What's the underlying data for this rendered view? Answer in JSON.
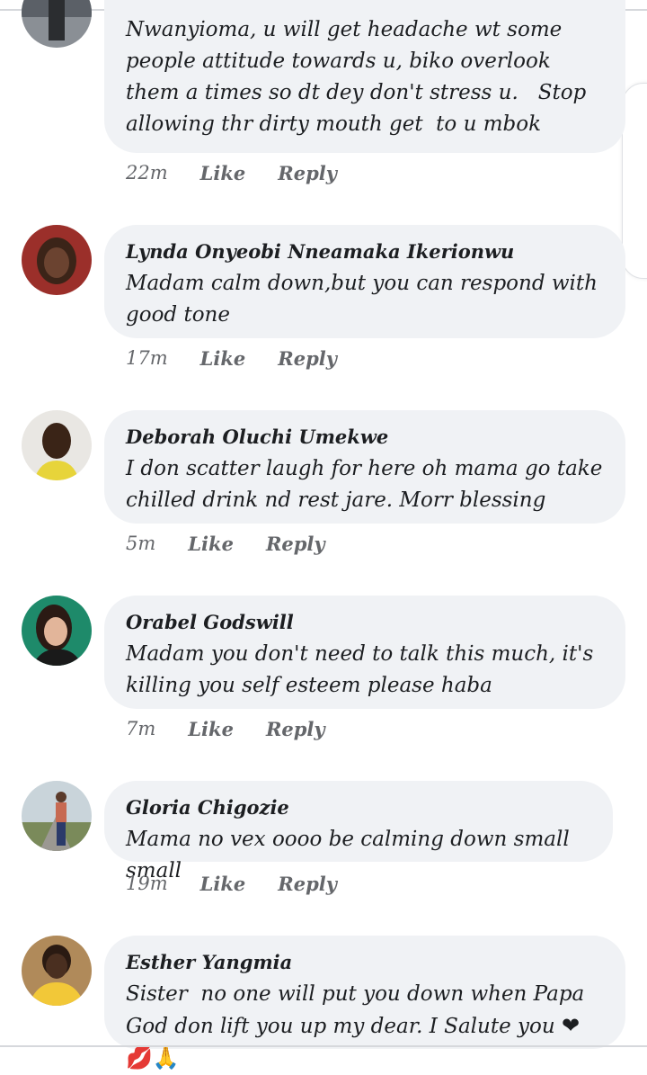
{
  "comments": [
    {
      "author": "",
      "text": "Nwanyioma, u will get headache wt some people attitude towards u, biko overlook them a times so dt dey don't stress u.   Stop allowing thr dirty mouth get  to u mbok",
      "time": "22m",
      "like": "Like",
      "reply": "Reply"
    },
    {
      "author": "Lynda Onyeobi Nneamaka Ikerionwu",
      "text": "Madam calm down,but you can respond with good tone",
      "time": "17m",
      "like": "Like",
      "reply": "Reply"
    },
    {
      "author": "Deborah Oluchi Umekwe",
      "text": "I don scatter laugh for here oh mama go take chilled drink nd rest jare. Morr blessing",
      "time": "5m",
      "like": "Like",
      "reply": "Reply"
    },
    {
      "author": "Orabel Godswill",
      "text": "Madam you don't need to talk this much, it's killing you self esteem please haba",
      "time": "7m",
      "like": "Like",
      "reply": "Reply"
    },
    {
      "author": "Gloria Chigozie",
      "text": "Mama no vex oooo be calming down small small",
      "time": "19m",
      "like": "Like",
      "reply": "Reply"
    },
    {
      "author": "Esther Yangmia",
      "text": "Sister  no one will put you down when Papa God don lift you up my dear. I Salute you",
      "emoji": "❤💋🙏",
      "time": "",
      "like": "",
      "reply": ""
    }
  ],
  "colors": {
    "bubble": "#f0f2f5",
    "meta": "#65676b",
    "text": "#1c1e21"
  }
}
